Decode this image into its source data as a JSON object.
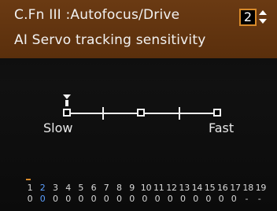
{
  "header": {
    "title": "C.Fn III :Autofocus/Drive",
    "subtitle": "AI Servo tracking sensitivity",
    "page_number": "2",
    "accent_color": "#d88a2a"
  },
  "slider": {
    "label_slow": "Slow",
    "label_fast": "Fast",
    "current_step_index": 0,
    "total_steps": 5
  },
  "function_list": {
    "numbers": [
      "1",
      "2",
      "3",
      "4",
      "5",
      "6",
      "7",
      "8",
      "9",
      "10",
      "11",
      "12",
      "13",
      "14",
      "15",
      "16",
      "17",
      "18",
      "19"
    ],
    "values": [
      "0",
      "0",
      "0",
      "0",
      "0",
      "0",
      "0",
      "0",
      "0",
      "0",
      "0",
      "0",
      "0",
      "0",
      "0",
      "0",
      "0",
      "-",
      "-"
    ],
    "highlight_index": 1,
    "highlight_color": "#5da0ff"
  }
}
